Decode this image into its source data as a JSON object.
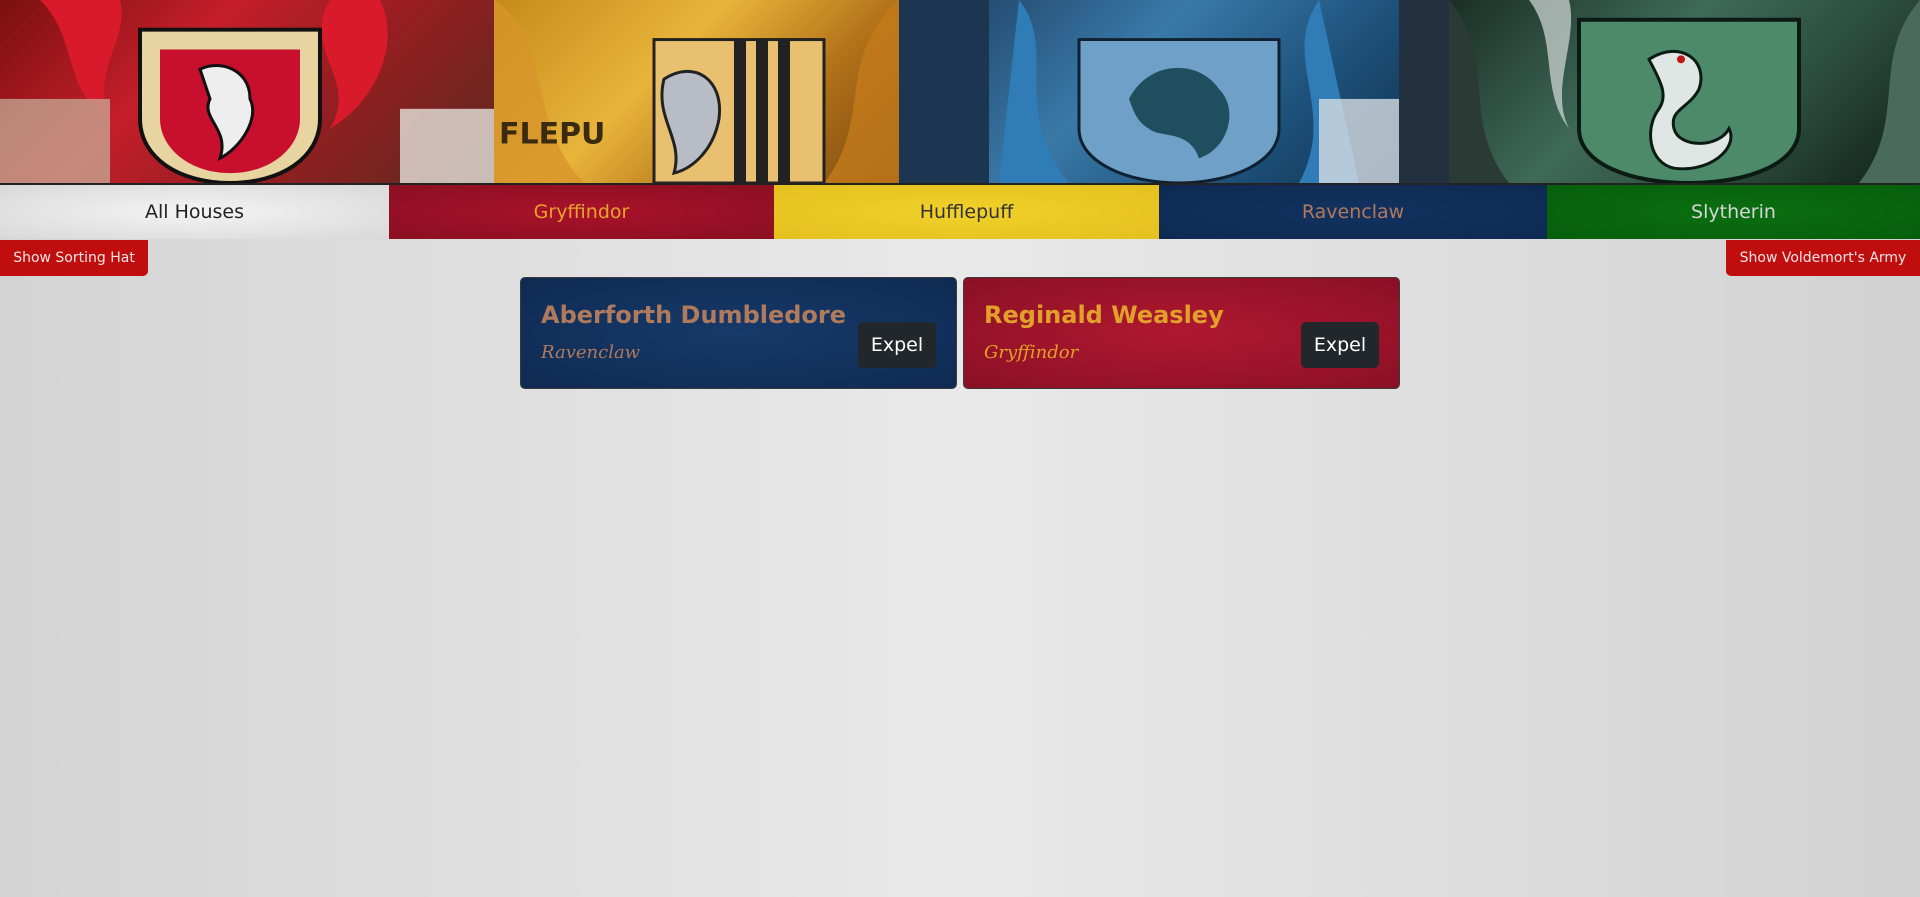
{
  "banner": {
    "crests": [
      "gryffindor-crest",
      "hufflepuff-crest",
      "ravenclaw-crest",
      "slytherin-crest"
    ]
  },
  "nav": {
    "tabs": [
      {
        "label": "All Houses",
        "color": "#e6e6e6"
      },
      {
        "label": "Gryffindor",
        "color": "#9b1027"
      },
      {
        "label": "Hufflepuff",
        "color": "#ecc924"
      },
      {
        "label": "Ravenclaw",
        "color": "#0f2d58"
      },
      {
        "label": "Slytherin",
        "color": "#086a0e"
      }
    ]
  },
  "actions": {
    "sorting_hat": "Show Sorting Hat",
    "voldemort_army": "Show Voldemort's Army",
    "accent": "#c00d0d"
  },
  "students": [
    {
      "name": "Aberforth Dumbledore",
      "house": "Ravenclaw",
      "action": "Expel"
    },
    {
      "name": "Reginald Weasley",
      "house": "Gryffindor",
      "action": "Expel"
    }
  ]
}
